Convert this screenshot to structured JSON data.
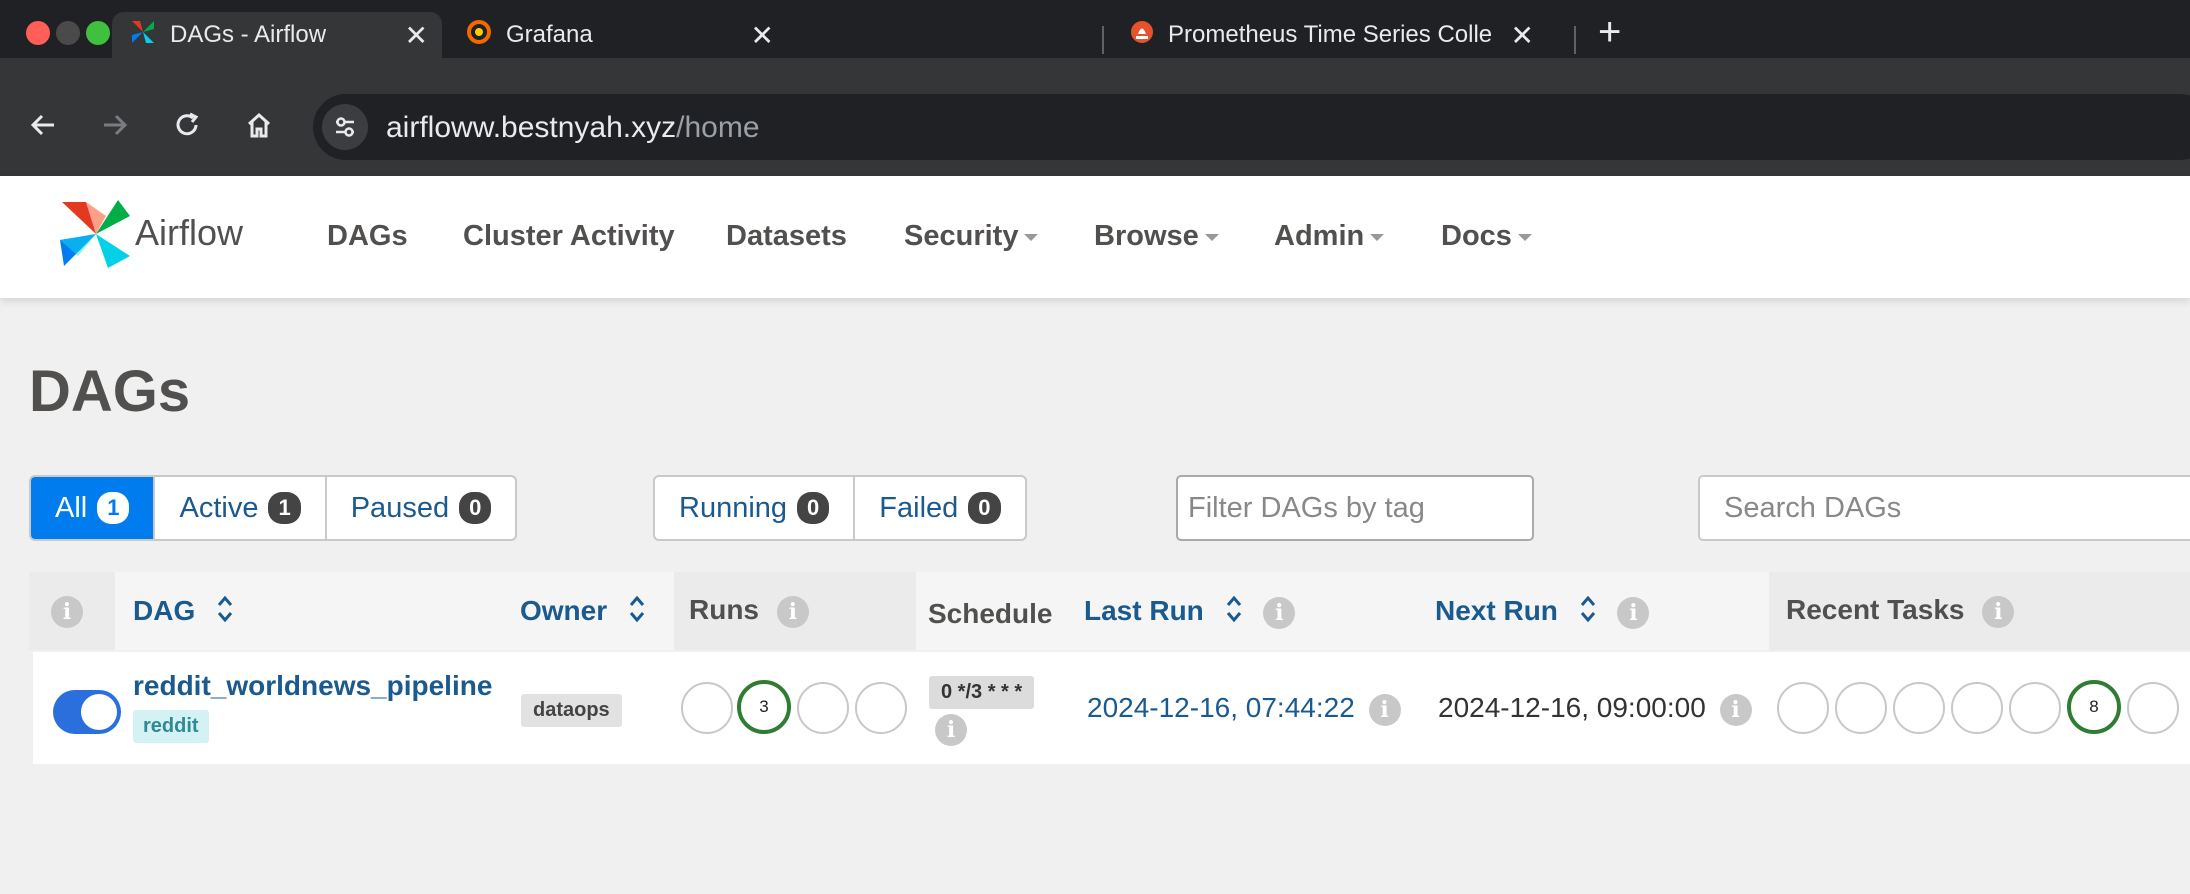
{
  "browser": {
    "tabs": [
      {
        "title": "DAGs - Airflow",
        "active": true,
        "icon": "airflow-icon"
      },
      {
        "title": "Grafana",
        "active": false,
        "icon": "grafana-icon"
      },
      {
        "title": "Prometheus Time Series Colle",
        "active": false,
        "icon": "prometheus-icon"
      }
    ],
    "url_host": "airfloww.bestnyah.xyz",
    "url_path": "/home"
  },
  "navbar": {
    "logo_text": "Airflow",
    "items": [
      "DAGs",
      "Cluster Activity",
      "Datasets",
      "Security",
      "Browse",
      "Admin",
      "Docs"
    ]
  },
  "page": {
    "title": "DAGs",
    "status_filters": [
      {
        "label": "All",
        "count": "1"
      },
      {
        "label": "Active",
        "count": "1"
      },
      {
        "label": "Paused",
        "count": "0"
      }
    ],
    "run_filters": [
      {
        "label": "Running",
        "count": "0"
      },
      {
        "label": "Failed",
        "count": "0"
      }
    ],
    "tag_filter_placeholder": "Filter DAGs by tag",
    "search_placeholder": "Search DAGs"
  },
  "table": {
    "headers": {
      "dag": "DAG",
      "owner": "Owner",
      "runs": "Runs",
      "schedule": "Schedule",
      "last_run": "Last Run",
      "next_run": "Next Run",
      "recent_tasks": "Recent Tasks"
    },
    "rows": [
      {
        "dag_id": "reddit_worldnews_pipeline",
        "tag": "reddit",
        "owner": "dataops",
        "runs_success_count": "3",
        "schedule": "0 */3 * * *",
        "last_run": "2024-12-16, 07:44:22",
        "next_run": "2024-12-16, 09:00:00",
        "recent_tasks_success_count": "8"
      }
    ]
  },
  "colors": {
    "accent": "#017cee",
    "link": "#1a5a8f",
    "success": "#2e7d32"
  }
}
